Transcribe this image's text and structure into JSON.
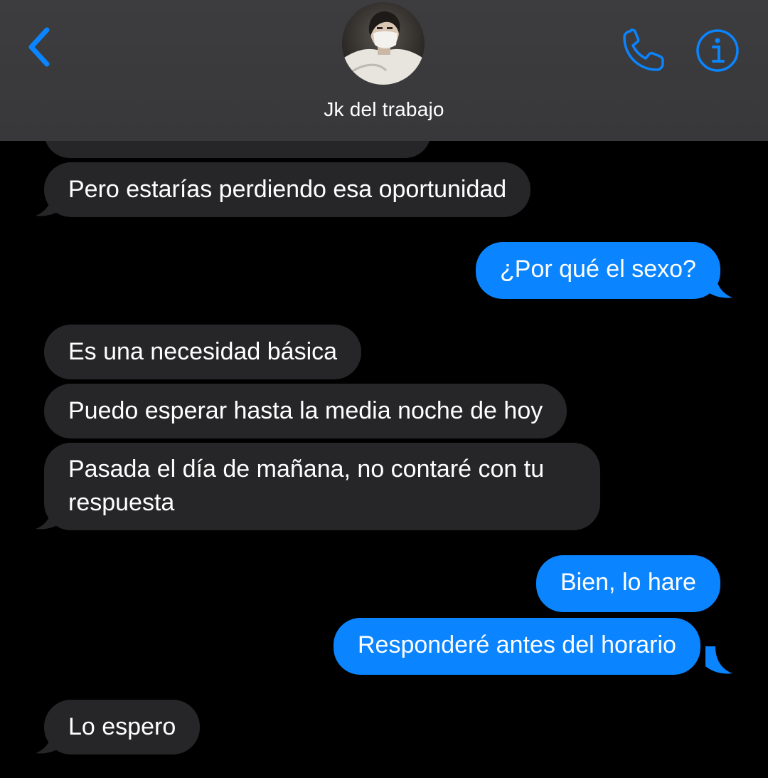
{
  "header": {
    "contact_name": "Jk del trabajo",
    "back_icon": "chevron-left-icon",
    "call_icon": "phone-icon",
    "info_icon": "info-icon",
    "accent_color": "#0a84ff"
  },
  "messages": [
    {
      "direction": "incoming",
      "text": "Pero estarías perdiendo esa oportunidad"
    },
    {
      "direction": "outgoing",
      "text": "¿Por qué el sexo?"
    },
    {
      "direction": "incoming",
      "text": "Es una necesidad básica"
    },
    {
      "direction": "incoming",
      "text": "Puedo esperar hasta la media noche de hoy"
    },
    {
      "direction": "incoming",
      "text": "Pasada el día de mañana, no contaré con tu respuesta"
    },
    {
      "direction": "outgoing",
      "text": "Bien, lo hare"
    },
    {
      "direction": "outgoing",
      "text": "Responderé antes del horario"
    },
    {
      "direction": "incoming",
      "text": "Lo espero"
    }
  ],
  "colors": {
    "incoming_bubble": "#262628",
    "outgoing_bubble": "#0a84ff",
    "header_bg": "#3a3a3c",
    "background": "#000000"
  }
}
